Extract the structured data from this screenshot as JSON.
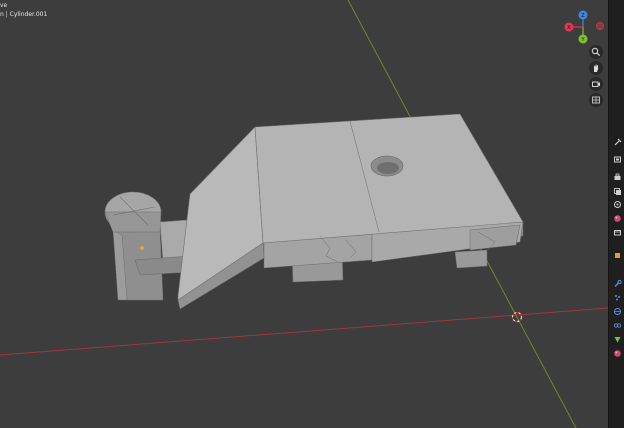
{
  "viewport": {
    "mode_text": "ve",
    "object_text": "n | Cylinder.001"
  },
  "axis_gizmo": {
    "labels": {
      "x": "X",
      "y": "Y",
      "z": "Z"
    },
    "colors": {
      "x": "#e0364f",
      "y": "#7fbf2f",
      "z": "#3f86e0",
      "neg": "#8a3a46"
    }
  },
  "nav_buttons": [
    {
      "name": "zoom-button",
      "icon": "magnifier-icon"
    },
    {
      "name": "pan-button",
      "icon": "hand-icon"
    },
    {
      "name": "camera-view-button",
      "icon": "camera-icon"
    },
    {
      "name": "perspective-toggle-button",
      "icon": "grid-icon"
    }
  ],
  "properties_tabs": [
    {
      "name": "tool-tab",
      "icon": "tool-icon",
      "color": "#cfcfcf"
    },
    {
      "name": "render-tab",
      "icon": "render-icon",
      "color": "#cfcfcf"
    },
    {
      "name": "output-tab",
      "icon": "printer-icon",
      "color": "#cfcfcf"
    },
    {
      "name": "view-layer-tab",
      "icon": "image-stack-icon",
      "color": "#cfcfcf"
    },
    {
      "name": "scene-tab",
      "icon": "scene-icon",
      "color": "#cfcfcf"
    },
    {
      "name": "world-tab",
      "icon": "world-icon",
      "color": "#d0486a"
    },
    {
      "name": "collection-tab",
      "icon": "collection-icon",
      "color": "#cfcfcf"
    },
    {
      "name": "object-tab",
      "icon": "object-icon",
      "color": "#e39a3a"
    },
    {
      "name": "modifiers-tab",
      "icon": "wrench-icon",
      "color": "#5a8fd6"
    },
    {
      "name": "particles-tab",
      "icon": "particles-icon",
      "color": "#5a8fd6"
    },
    {
      "name": "physics-tab",
      "icon": "physics-icon",
      "color": "#5a8fd6"
    },
    {
      "name": "constraints-tab",
      "icon": "constraints-icon",
      "color": "#5a8fd6"
    },
    {
      "name": "data-tab",
      "icon": "mesh-data-icon",
      "color": "#6fc24a"
    },
    {
      "name": "material-tab",
      "icon": "material-icon",
      "color": "#d0486a"
    }
  ],
  "colors": {
    "background": "#3d3d3d",
    "axis_x": "#a0363f",
    "axis_y": "#6a8a2a",
    "mesh_light": "#b8b8b8",
    "origin": "#e8a040"
  }
}
